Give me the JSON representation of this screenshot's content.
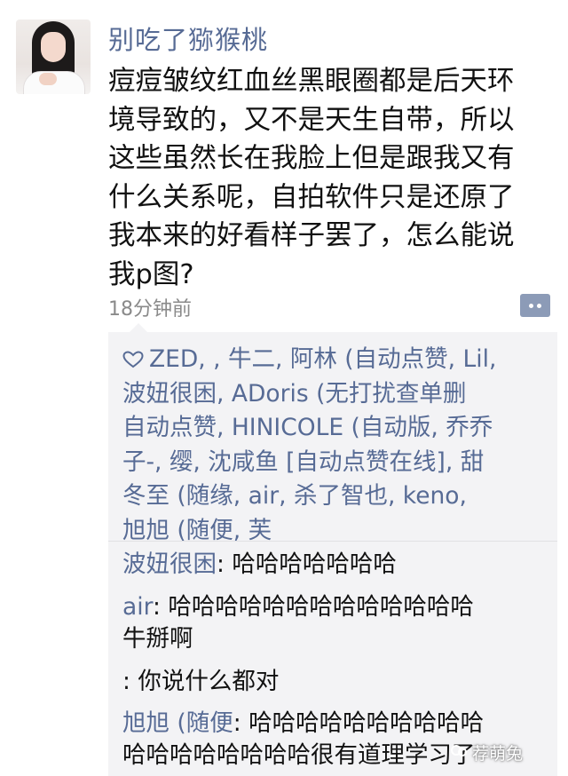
{
  "post": {
    "username": "别吃了猕猴桃",
    "text_lines": [
      "痘痘皱纹红血丝黑眼圈都是后天环",
      "境导致的，又不是天生自带，所以",
      "这些虽然长在我脸上但是跟我又有",
      "什么关系呢，自拍软件只是还原了",
      "我本来的好看样子罢了，怎么能说",
      "我p图?"
    ],
    "time": "18分钟前",
    "avatar_icon": "user-avatar-photo",
    "more_icon": "more-dots-icon"
  },
  "likes": {
    "icon": "heart-outline-icon",
    "lines": [
      "ZED, , 牛二, 阿林 (自动点赞, Lil,",
      "波妞很困, ADoris (无打扰查单删",
      "自动点赞, HINICOLE (自动版, 乔乔",
      "子-, 缨, 沈咸鱼 [自动点赞在线], 甜",
      "冬至 (随缘, air, 杀了智也, keno,",
      "旭旭 (随便, 芙"
    ]
  },
  "comments": [
    {
      "author": "波妞很困",
      "lines": [
        "哈哈哈哈哈哈哈"
      ]
    },
    {
      "author": "air",
      "lines": [
        "哈哈哈哈哈哈哈哈哈哈哈哈哈",
        "牛掰啊"
      ]
    },
    {
      "author": "",
      "lines": [
        "你说什么都对"
      ]
    },
    {
      "author": "旭旭 (随便",
      "lines": [
        "哈哈哈哈哈哈哈哈哈哈",
        "哈哈哈哈哈哈哈哈很有道理学习了"
      ]
    }
  ],
  "watermark": "荐萌兔",
  "colors": {
    "link_blue": "#576b95",
    "comment_bg": "#f3f3f5",
    "time_gray": "#8a8a8a"
  }
}
